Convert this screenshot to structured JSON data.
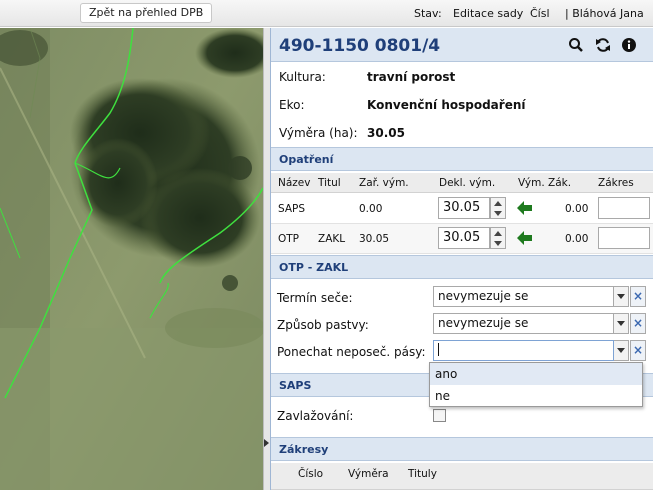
{
  "topbar": {
    "back_label": "Zpět na přehled DPB",
    "status_label": "Stav:",
    "status_value": "Editace sady",
    "cislo_label": "Číslo",
    "user": "| Bláhová Jana"
  },
  "panel": {
    "title": "490-1150 0801/4",
    "icons": [
      "search-icon",
      "refresh-icon",
      "info-icon"
    ]
  },
  "info": {
    "kultura_label": "Kultura:",
    "kultura_value": "travní porost",
    "eko_label": "Eko:",
    "eko_value": "Konvenční hospodaření",
    "vymera_label": "Výměra (ha):",
    "vymera_value": "30.05"
  },
  "opatreni": {
    "heading": "Opatření",
    "columns": [
      "Název",
      "Titul",
      "Zař. vým.",
      "Dekl. vým.",
      "Vým. Zák.",
      "Zákres"
    ],
    "rows": [
      {
        "nazev": "SAPS",
        "titul": "",
        "zar_vym": "0.00",
        "dekl_vym": "30.05",
        "vym_zak": "0.00"
      },
      {
        "nazev": "OTP",
        "titul": "ZAKL",
        "zar_vym": "30.05",
        "dekl_vym": "30.05",
        "vym_zak": "0.00"
      }
    ]
  },
  "otp_zakl": {
    "heading": "OTP - ZAKL",
    "termin_label": "Termín seče:",
    "termin_value": "nevymezuje se",
    "zpusob_label": "Způsob pastvy:",
    "zpusob_value": "nevymezuje se",
    "ponechat_label": "Ponechat neposeč. pásy:",
    "ponechat_value": "",
    "dropdown_options": [
      "ano",
      "ne"
    ]
  },
  "saps": {
    "heading": "SAPS",
    "zavlazovani_label": "Zavlažování:",
    "zavlazovani_checked": false
  },
  "zakresy": {
    "heading": "Zákresy",
    "columns": [
      "Číslo",
      "Výměra",
      "Tituly"
    ]
  },
  "colors": {
    "accent": "#1f3f79",
    "section_bg": "#dce6f2",
    "arrow_green": "#1e7a1e",
    "parcel_outline": "#3fe03f"
  }
}
